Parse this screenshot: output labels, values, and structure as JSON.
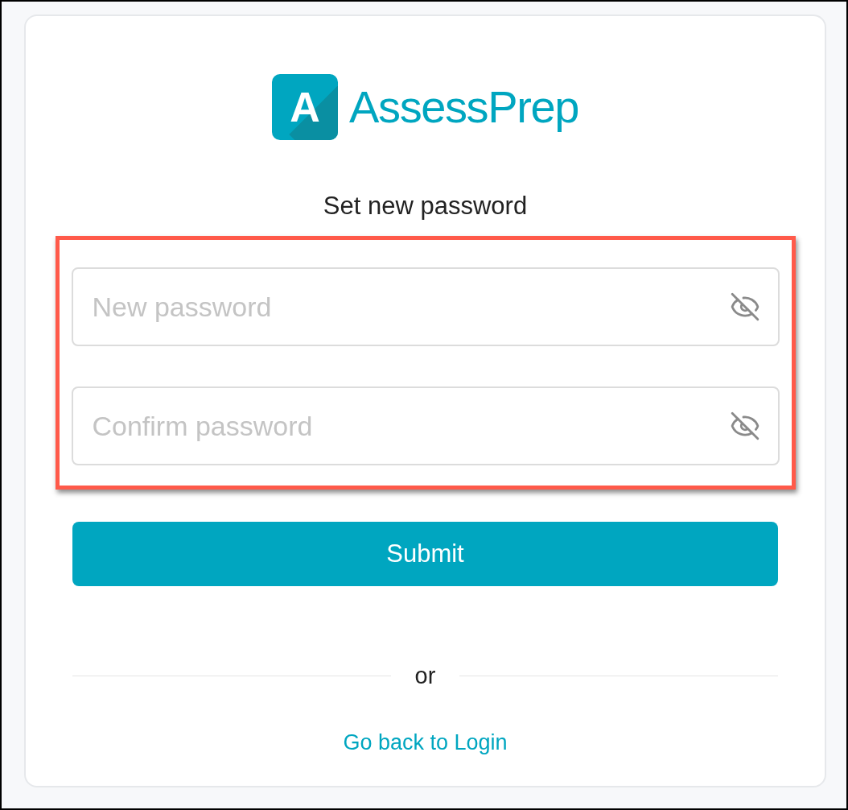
{
  "logo": {
    "letter": "A",
    "name": "AssessPrep"
  },
  "heading": "Set new password",
  "highlighted": true,
  "fields": [
    {
      "placeholder": "New password"
    },
    {
      "placeholder": "Confirm password"
    }
  ],
  "submit": "Submit",
  "divider": "or",
  "link": "Go back to Login"
}
